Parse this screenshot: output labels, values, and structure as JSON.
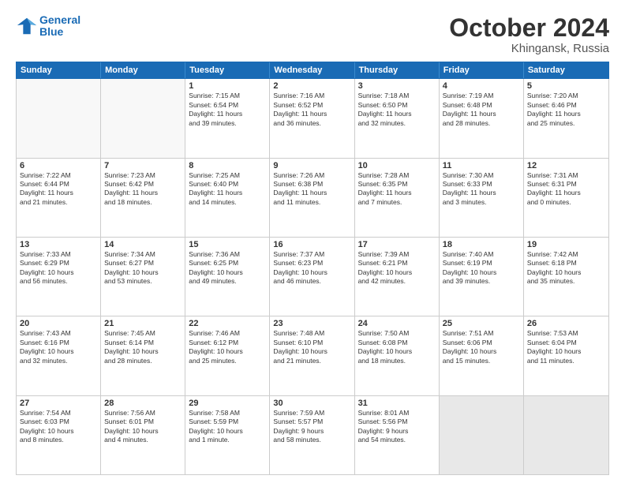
{
  "header": {
    "logo_line1": "General",
    "logo_line2": "Blue",
    "main_title": "October 2024",
    "subtitle": "Khingansk, Russia"
  },
  "days_of_week": [
    "Sunday",
    "Monday",
    "Tuesday",
    "Wednesday",
    "Thursday",
    "Friday",
    "Saturday"
  ],
  "rows": [
    [
      {
        "day": "",
        "lines": []
      },
      {
        "day": "",
        "lines": []
      },
      {
        "day": "1",
        "lines": [
          "Sunrise: 7:15 AM",
          "Sunset: 6:54 PM",
          "Daylight: 11 hours",
          "and 39 minutes."
        ]
      },
      {
        "day": "2",
        "lines": [
          "Sunrise: 7:16 AM",
          "Sunset: 6:52 PM",
          "Daylight: 11 hours",
          "and 36 minutes."
        ]
      },
      {
        "day": "3",
        "lines": [
          "Sunrise: 7:18 AM",
          "Sunset: 6:50 PM",
          "Daylight: 11 hours",
          "and 32 minutes."
        ]
      },
      {
        "day": "4",
        "lines": [
          "Sunrise: 7:19 AM",
          "Sunset: 6:48 PM",
          "Daylight: 11 hours",
          "and 28 minutes."
        ]
      },
      {
        "day": "5",
        "lines": [
          "Sunrise: 7:20 AM",
          "Sunset: 6:46 PM",
          "Daylight: 11 hours",
          "and 25 minutes."
        ]
      }
    ],
    [
      {
        "day": "6",
        "lines": [
          "Sunrise: 7:22 AM",
          "Sunset: 6:44 PM",
          "Daylight: 11 hours",
          "and 21 minutes."
        ]
      },
      {
        "day": "7",
        "lines": [
          "Sunrise: 7:23 AM",
          "Sunset: 6:42 PM",
          "Daylight: 11 hours",
          "and 18 minutes."
        ]
      },
      {
        "day": "8",
        "lines": [
          "Sunrise: 7:25 AM",
          "Sunset: 6:40 PM",
          "Daylight: 11 hours",
          "and 14 minutes."
        ]
      },
      {
        "day": "9",
        "lines": [
          "Sunrise: 7:26 AM",
          "Sunset: 6:38 PM",
          "Daylight: 11 hours",
          "and 11 minutes."
        ]
      },
      {
        "day": "10",
        "lines": [
          "Sunrise: 7:28 AM",
          "Sunset: 6:35 PM",
          "Daylight: 11 hours",
          "and 7 minutes."
        ]
      },
      {
        "day": "11",
        "lines": [
          "Sunrise: 7:30 AM",
          "Sunset: 6:33 PM",
          "Daylight: 11 hours",
          "and 3 minutes."
        ]
      },
      {
        "day": "12",
        "lines": [
          "Sunrise: 7:31 AM",
          "Sunset: 6:31 PM",
          "Daylight: 11 hours",
          "and 0 minutes."
        ]
      }
    ],
    [
      {
        "day": "13",
        "lines": [
          "Sunrise: 7:33 AM",
          "Sunset: 6:29 PM",
          "Daylight: 10 hours",
          "and 56 minutes."
        ]
      },
      {
        "day": "14",
        "lines": [
          "Sunrise: 7:34 AM",
          "Sunset: 6:27 PM",
          "Daylight: 10 hours",
          "and 53 minutes."
        ]
      },
      {
        "day": "15",
        "lines": [
          "Sunrise: 7:36 AM",
          "Sunset: 6:25 PM",
          "Daylight: 10 hours",
          "and 49 minutes."
        ]
      },
      {
        "day": "16",
        "lines": [
          "Sunrise: 7:37 AM",
          "Sunset: 6:23 PM",
          "Daylight: 10 hours",
          "and 46 minutes."
        ]
      },
      {
        "day": "17",
        "lines": [
          "Sunrise: 7:39 AM",
          "Sunset: 6:21 PM",
          "Daylight: 10 hours",
          "and 42 minutes."
        ]
      },
      {
        "day": "18",
        "lines": [
          "Sunrise: 7:40 AM",
          "Sunset: 6:19 PM",
          "Daylight: 10 hours",
          "and 39 minutes."
        ]
      },
      {
        "day": "19",
        "lines": [
          "Sunrise: 7:42 AM",
          "Sunset: 6:18 PM",
          "Daylight: 10 hours",
          "and 35 minutes."
        ]
      }
    ],
    [
      {
        "day": "20",
        "lines": [
          "Sunrise: 7:43 AM",
          "Sunset: 6:16 PM",
          "Daylight: 10 hours",
          "and 32 minutes."
        ]
      },
      {
        "day": "21",
        "lines": [
          "Sunrise: 7:45 AM",
          "Sunset: 6:14 PM",
          "Daylight: 10 hours",
          "and 28 minutes."
        ]
      },
      {
        "day": "22",
        "lines": [
          "Sunrise: 7:46 AM",
          "Sunset: 6:12 PM",
          "Daylight: 10 hours",
          "and 25 minutes."
        ]
      },
      {
        "day": "23",
        "lines": [
          "Sunrise: 7:48 AM",
          "Sunset: 6:10 PM",
          "Daylight: 10 hours",
          "and 21 minutes."
        ]
      },
      {
        "day": "24",
        "lines": [
          "Sunrise: 7:50 AM",
          "Sunset: 6:08 PM",
          "Daylight: 10 hours",
          "and 18 minutes."
        ]
      },
      {
        "day": "25",
        "lines": [
          "Sunrise: 7:51 AM",
          "Sunset: 6:06 PM",
          "Daylight: 10 hours",
          "and 15 minutes."
        ]
      },
      {
        "day": "26",
        "lines": [
          "Sunrise: 7:53 AM",
          "Sunset: 6:04 PM",
          "Daylight: 10 hours",
          "and 11 minutes."
        ]
      }
    ],
    [
      {
        "day": "27",
        "lines": [
          "Sunrise: 7:54 AM",
          "Sunset: 6:03 PM",
          "Daylight: 10 hours",
          "and 8 minutes."
        ]
      },
      {
        "day": "28",
        "lines": [
          "Sunrise: 7:56 AM",
          "Sunset: 6:01 PM",
          "Daylight: 10 hours",
          "and 4 minutes."
        ]
      },
      {
        "day": "29",
        "lines": [
          "Sunrise: 7:58 AM",
          "Sunset: 5:59 PM",
          "Daylight: 10 hours",
          "and 1 minute."
        ]
      },
      {
        "day": "30",
        "lines": [
          "Sunrise: 7:59 AM",
          "Sunset: 5:57 PM",
          "Daylight: 9 hours",
          "and 58 minutes."
        ]
      },
      {
        "day": "31",
        "lines": [
          "Sunrise: 8:01 AM",
          "Sunset: 5:56 PM",
          "Daylight: 9 hours",
          "and 54 minutes."
        ]
      },
      {
        "day": "",
        "lines": []
      },
      {
        "day": "",
        "lines": []
      }
    ]
  ]
}
